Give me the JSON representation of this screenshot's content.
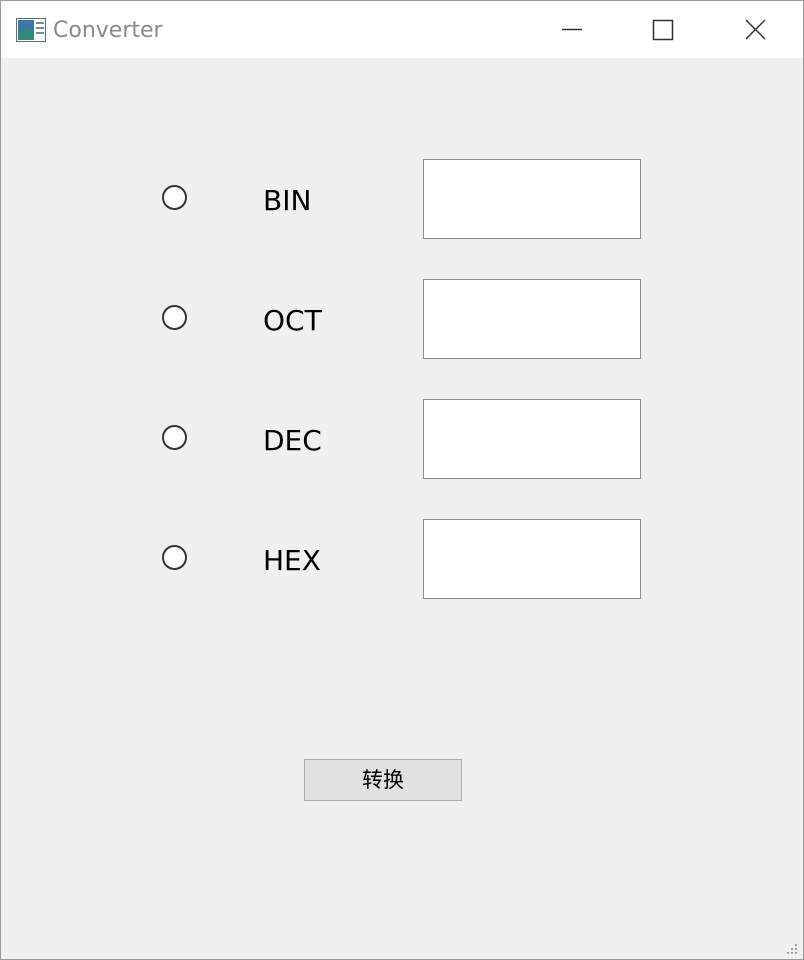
{
  "window": {
    "title": "Converter",
    "app_icon": "app-window-icon",
    "controls": {
      "minimize_icon": "minimize-icon",
      "maximize_icon": "maximize-icon",
      "close_icon": "close-icon"
    }
  },
  "form": {
    "rows": [
      {
        "label": "BIN",
        "value": "",
        "selected": false
      },
      {
        "label": "OCT",
        "value": "",
        "selected": false
      },
      {
        "label": "DEC",
        "value": "",
        "selected": false
      },
      {
        "label": "HEX",
        "value": "",
        "selected": false
      }
    ],
    "convert_button_label": "转换"
  },
  "colors": {
    "window_bg": "#f0f0f0",
    "titlebar_bg": "#ffffff",
    "title_text": "#8a8a8a",
    "button_bg": "#e1e1e1"
  }
}
